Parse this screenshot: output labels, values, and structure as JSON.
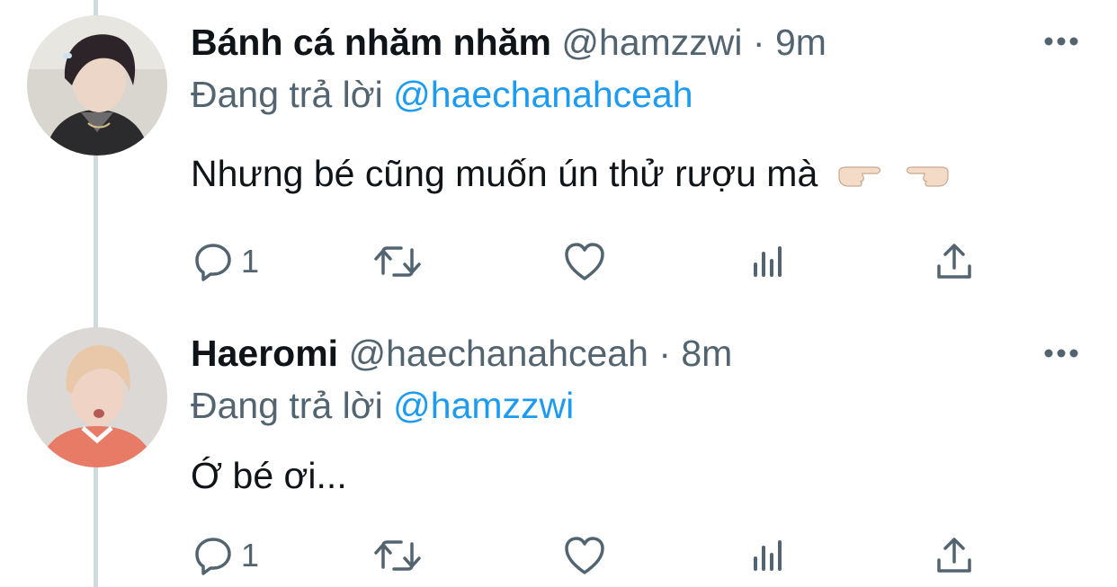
{
  "tweets": [
    {
      "name": "Bánh cá nhăm nhăm",
      "handle": "@hamzzwi",
      "separator": " · ",
      "time": "9m",
      "reply_prefix": "Đang trả lời ",
      "reply_to": "@haechanahceah",
      "text": "Nhưng bé cũng muốn ún thử rượu mà",
      "emoji": [
        "backhand-index-pointing-right",
        "backhand-index-pointing-right"
      ],
      "reply_count": "1"
    },
    {
      "name": "Haeromi",
      "handle": "@haechanahceah",
      "separator": " · ",
      "time": "8m",
      "reply_prefix": "Đang trả lời ",
      "reply_to": "@hamzzwi",
      "text": "Ớ bé ơi...",
      "reply_count": "1"
    }
  ],
  "icons": {
    "reply": "reply-icon",
    "retweet": "retweet-icon",
    "like": "heart-icon",
    "views": "views-icon",
    "share": "share-icon",
    "more": "more-icon"
  },
  "colors": {
    "text": "#0f1419",
    "secondary": "#536471",
    "mention": "#1d9bf0",
    "thread_line": "#cfd9de"
  }
}
